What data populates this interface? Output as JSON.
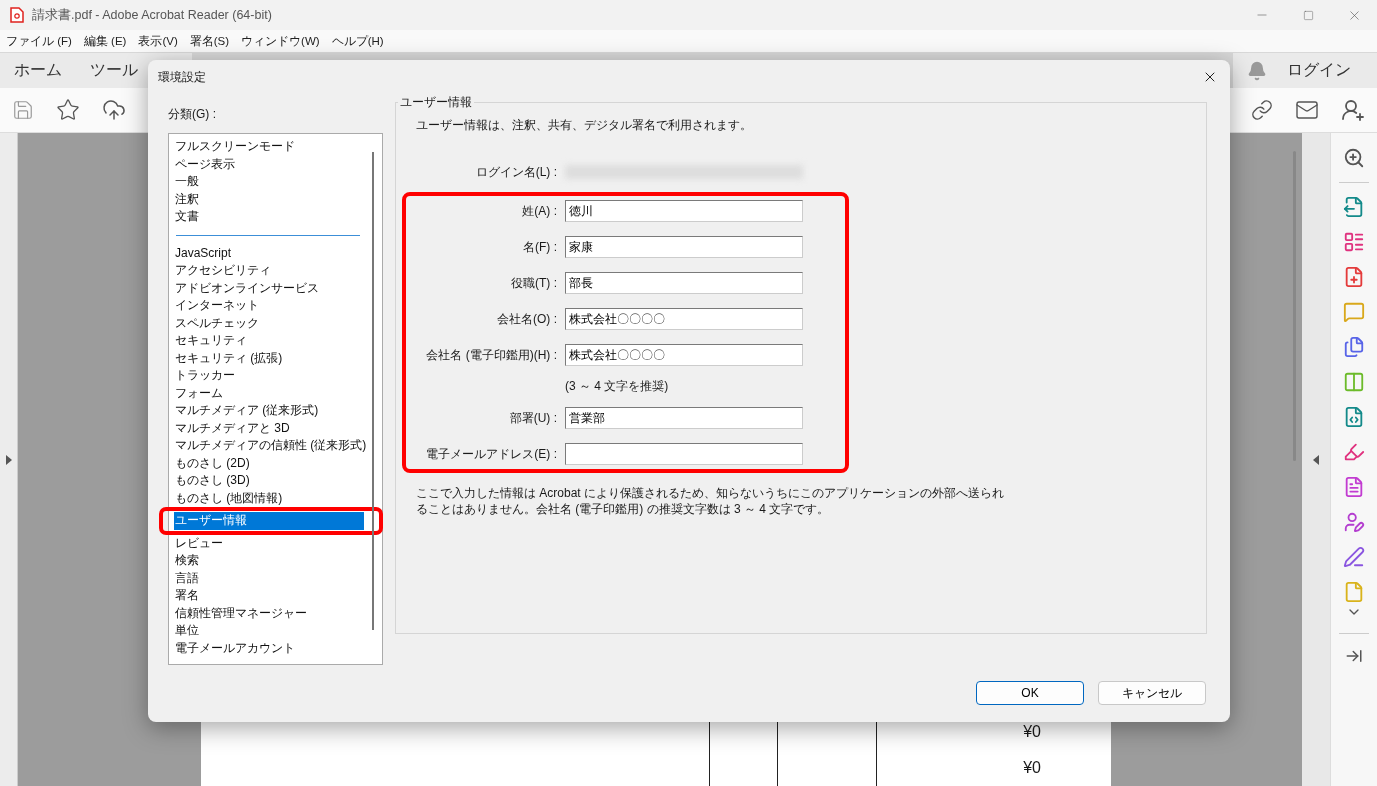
{
  "window": {
    "title": "請求書.pdf - Adobe Acrobat Reader (64-bit)"
  },
  "menu": [
    "ファイル (F)",
    "編集 (E)",
    "表示(V)",
    "署名(S)",
    "ウィンドウ(W)",
    "ヘルプ(H)"
  ],
  "nav_tabs": [
    "ホーム",
    "ツール"
  ],
  "login_button": "ログイン",
  "document": {
    "rows": [
      {
        "amount": "¥0"
      },
      {
        "amount": "¥0"
      }
    ]
  },
  "dialog": {
    "title": "環境設定",
    "category_label": "分類(G) :",
    "category_groups": [
      {
        "items": [
          {
            "label": "フルスクリーンモード",
            "selected": false,
            "highlighted": false
          },
          {
            "label": "ページ表示",
            "selected": false,
            "highlighted": false
          },
          {
            "label": "一般",
            "selected": false,
            "highlighted": false
          },
          {
            "label": "注釈",
            "selected": false,
            "highlighted": false
          },
          {
            "label": "文書",
            "selected": false,
            "highlighted": false
          }
        ]
      },
      {
        "items": [
          {
            "label": "JavaScript",
            "selected": false,
            "highlighted": false
          },
          {
            "label": "アクセシビリティ",
            "selected": false,
            "highlighted": false
          },
          {
            "label": "アドビオンラインサービス",
            "selected": false,
            "highlighted": false
          },
          {
            "label": "インターネット",
            "selected": false,
            "highlighted": false
          },
          {
            "label": "スペルチェック",
            "selected": false,
            "highlighted": false
          },
          {
            "label": "セキュリティ",
            "selected": false,
            "highlighted": false
          },
          {
            "label": "セキュリティ (拡張)",
            "selected": false,
            "highlighted": false
          },
          {
            "label": "トラッカー",
            "selected": false,
            "highlighted": false
          },
          {
            "label": "フォーム",
            "selected": false,
            "highlighted": false
          },
          {
            "label": "マルチメディア (従来形式)",
            "selected": false,
            "highlighted": false
          },
          {
            "label": "マルチメディアと 3D",
            "selected": false,
            "highlighted": false
          },
          {
            "label": "マルチメディアの信頼性 (従来形式)",
            "selected": false,
            "highlighted": false
          },
          {
            "label": "ものさし (2D)",
            "selected": false,
            "highlighted": false
          },
          {
            "label": "ものさし (3D)",
            "selected": false,
            "highlighted": false
          },
          {
            "label": "ものさし (地図情報)",
            "selected": false,
            "highlighted": false
          },
          {
            "label": "ユーザー情報",
            "selected": true,
            "highlighted": true
          },
          {
            "label": "レビュー",
            "selected": false,
            "highlighted": false
          },
          {
            "label": "検索",
            "selected": false,
            "highlighted": false
          },
          {
            "label": "言語",
            "selected": false,
            "highlighted": false
          },
          {
            "label": "署名",
            "selected": false,
            "highlighted": false
          },
          {
            "label": "信頼性管理マネージャー",
            "selected": false,
            "highlighted": false
          },
          {
            "label": "単位",
            "selected": false,
            "highlighted": false
          },
          {
            "label": "電子メールアカウント",
            "selected": false,
            "highlighted": false
          }
        ]
      }
    ],
    "section": {
      "title": "ユーザー情報",
      "description": "ユーザー情報は、注釈、共有、デジタル署名で利用されます。",
      "login_label": "ログイン名(L) :",
      "fields_highlighted": true,
      "fields": [
        {
          "label": "姓(A) :",
          "value": "徳川"
        },
        {
          "label": "名(F) :",
          "value": "家康"
        },
        {
          "label": "役職(T) :",
          "value": "部長"
        },
        {
          "label": "会社名(O) :",
          "value": "株式会社〇〇〇〇"
        },
        {
          "label": "会社名 (電子印鑑用)(H) :",
          "value": "株式会社〇〇〇〇",
          "hint": "(3 ～ 4 文字を推奨)"
        },
        {
          "label": "部署(U) :",
          "value": "営業部"
        },
        {
          "label": "電子メールアドレス(E) :"
        }
      ],
      "note": "ここで入力した情報は Acrobat により保護されるため、知らないうちにこのアプリケーションの外部へ送られることはありません。会社名 (電子印鑑用) の推奨文字数は 3 ～ 4 文字です。"
    },
    "buttons": [
      {
        "label": "OK",
        "default": true
      },
      {
        "label": "キャンセル",
        "default": false
      }
    ]
  }
}
